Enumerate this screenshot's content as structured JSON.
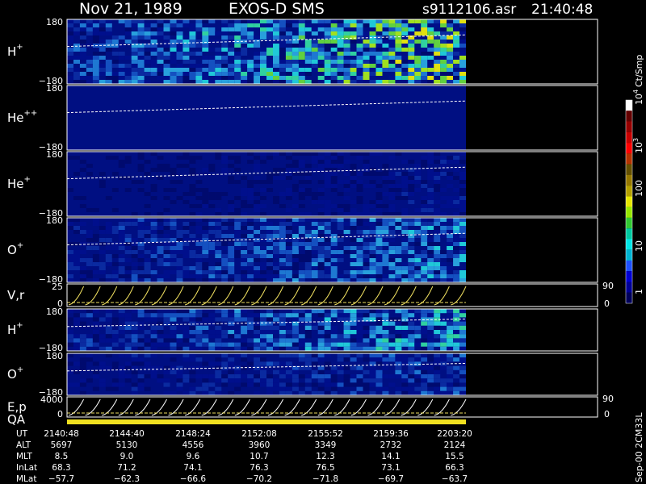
{
  "header": {
    "date": "Nov 21, 1989",
    "instrument": "EXOS-D SMS",
    "file": "s9112106.asr",
    "time": "21:40:48"
  },
  "panels": [
    {
      "id": "h-plus",
      "label": "H",
      "sup": "+",
      "ymax": "180",
      "ymin": "−180",
      "kind": "spectrogram",
      "intensity": 0.55
    },
    {
      "id": "he-plusplus",
      "label": "He",
      "sup": "++",
      "ymax": "180",
      "ymin": "−180",
      "kind": "spectrogram",
      "intensity": 0.05
    },
    {
      "id": "he-plus",
      "label": "He",
      "sup": "+",
      "ymax": "180",
      "ymin": "−180",
      "kind": "spectrogram",
      "intensity": 0.15
    },
    {
      "id": "o-plus",
      "label": "O",
      "sup": "+",
      "ymax": "180",
      "ymin": "−180",
      "kind": "spectrogram",
      "intensity": 0.35
    },
    {
      "id": "vr",
      "label": "V,r",
      "sup": "",
      "ymax": "25",
      "ymin": "0",
      "rmax": "90",
      "rmin": "0",
      "kind": "lines"
    },
    {
      "id": "h-plus-2",
      "label": "H",
      "sup": "+",
      "ymax": "180",
      "ymin": "−180",
      "kind": "spectrogram",
      "intensity": 0.4
    },
    {
      "id": "o-plus-2",
      "label": "O",
      "sup": "+",
      "ymax": "180",
      "ymin": "−180",
      "kind": "spectrogram",
      "intensity": 0.25
    },
    {
      "id": "ep",
      "label": "E,p",
      "sup": "",
      "ymax": "4000",
      "ymin": "0",
      "rmax": "90",
      "rmin": "0",
      "kind": "lines"
    }
  ],
  "qa_label": "QA",
  "colorbar": {
    "unit": "Ct/Smp",
    "ticks": [
      "1",
      "10",
      "100",
      "10",
      "10"
    ],
    "tick_sups": [
      "",
      "",
      "",
      "3",
      "4"
    ],
    "colors": [
      "#00005a",
      "#000096",
      "#0000d2",
      "#1e50ff",
      "#00b4d2",
      "#00e6e6",
      "#00c8a0",
      "#32c832",
      "#96e600",
      "#e6e600",
      "#b4a000",
      "#967800",
      "#645000",
      "#b43200",
      "#ff0000",
      "#c80000",
      "#960000",
      "#640000",
      "#ffffff"
    ]
  },
  "table": {
    "row_labels": [
      "UT",
      "ALT",
      "MLT",
      "InLat",
      "MLat"
    ],
    "columns": [
      [
        "2140:48",
        "5697",
        "8.5",
        "68.3",
        "−57.7"
      ],
      [
        "2144:40",
        "5130",
        "9.0",
        "71.2",
        "−62.3"
      ],
      [
        "2148:24",
        "4556",
        "9.6",
        "74.1",
        "−66.6"
      ],
      [
        "2152:08",
        "3960",
        "10.7",
        "76.3",
        "−70.2"
      ],
      [
        "2155:52",
        "3349",
        "12.3",
        "76.5",
        "−71.8"
      ],
      [
        "2159:36",
        "2732",
        "14.1",
        "73.1",
        "−69.7"
      ],
      [
        "2203:20",
        "2124",
        "15.5",
        "66.3",
        "−63.7"
      ]
    ]
  },
  "footer_code": "Sep-00 2CM33L",
  "chart_data": {
    "type": "heatmap",
    "title": "Nov 21, 1989 EXOS-D SMS",
    "x": [
      "2140:48",
      "2144:40",
      "2148:24",
      "2152:08",
      "2155:52",
      "2159:36",
      "2203:20"
    ],
    "series": [
      {
        "name": "H+",
        "ylim": [
          -180,
          180
        ]
      },
      {
        "name": "He++",
        "ylim": [
          -180,
          180
        ]
      },
      {
        "name": "He+",
        "ylim": [
          -180,
          180
        ]
      },
      {
        "name": "O+",
        "ylim": [
          -180,
          180
        ]
      },
      {
        "name": "V,r",
        "ylim": [
          0,
          25
        ]
      },
      {
        "name": "H+",
        "ylim": [
          -180,
          180
        ]
      },
      {
        "name": "O+",
        "ylim": [
          -180,
          180
        ]
      },
      {
        "name": "E,p",
        "ylim": [
          0,
          4000
        ]
      }
    ],
    "colorbar_range": [
      1,
      10000
    ],
    "colorbar_unit": "Ct/Smp"
  }
}
